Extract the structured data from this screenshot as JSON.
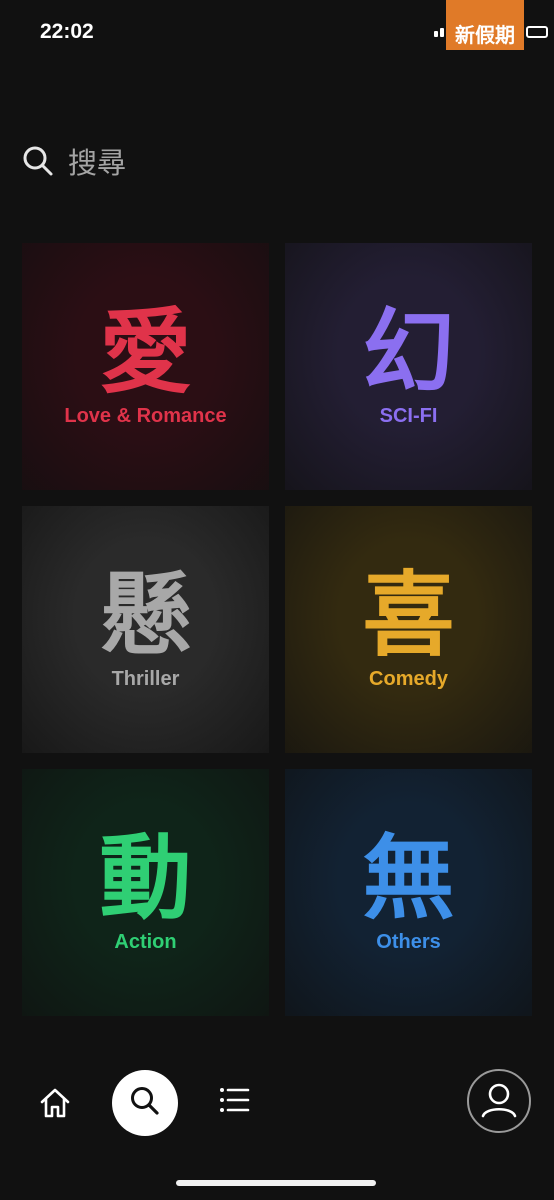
{
  "status": {
    "time": "22:02",
    "watermark": "新假期"
  },
  "search": {
    "label": "搜尋"
  },
  "categories": [
    {
      "glyph": "愛",
      "label": "Love & Romance",
      "color": "#e0334a",
      "bg": "#2b0e14"
    },
    {
      "glyph": "幻",
      "label": "SCI-FI",
      "color": "#8b6ff0",
      "bg": "#231e33"
    },
    {
      "glyph": "懸",
      "label": "Thriller",
      "color": "#a8a8a8",
      "bg": "#2a2a2a"
    },
    {
      "glyph": "喜",
      "label": "Comedy",
      "color": "#e6a92a",
      "bg": "#332a10"
    },
    {
      "glyph": "動",
      "label": "Action",
      "color": "#2fcf74",
      "bg": "#0f2419"
    },
    {
      "glyph": "無",
      "label": "Others",
      "color": "#3d8fe8",
      "bg": "#122233"
    }
  ],
  "nav": {
    "icons": [
      "home-icon",
      "search-icon",
      "list-icon",
      "profile-icon"
    ]
  }
}
